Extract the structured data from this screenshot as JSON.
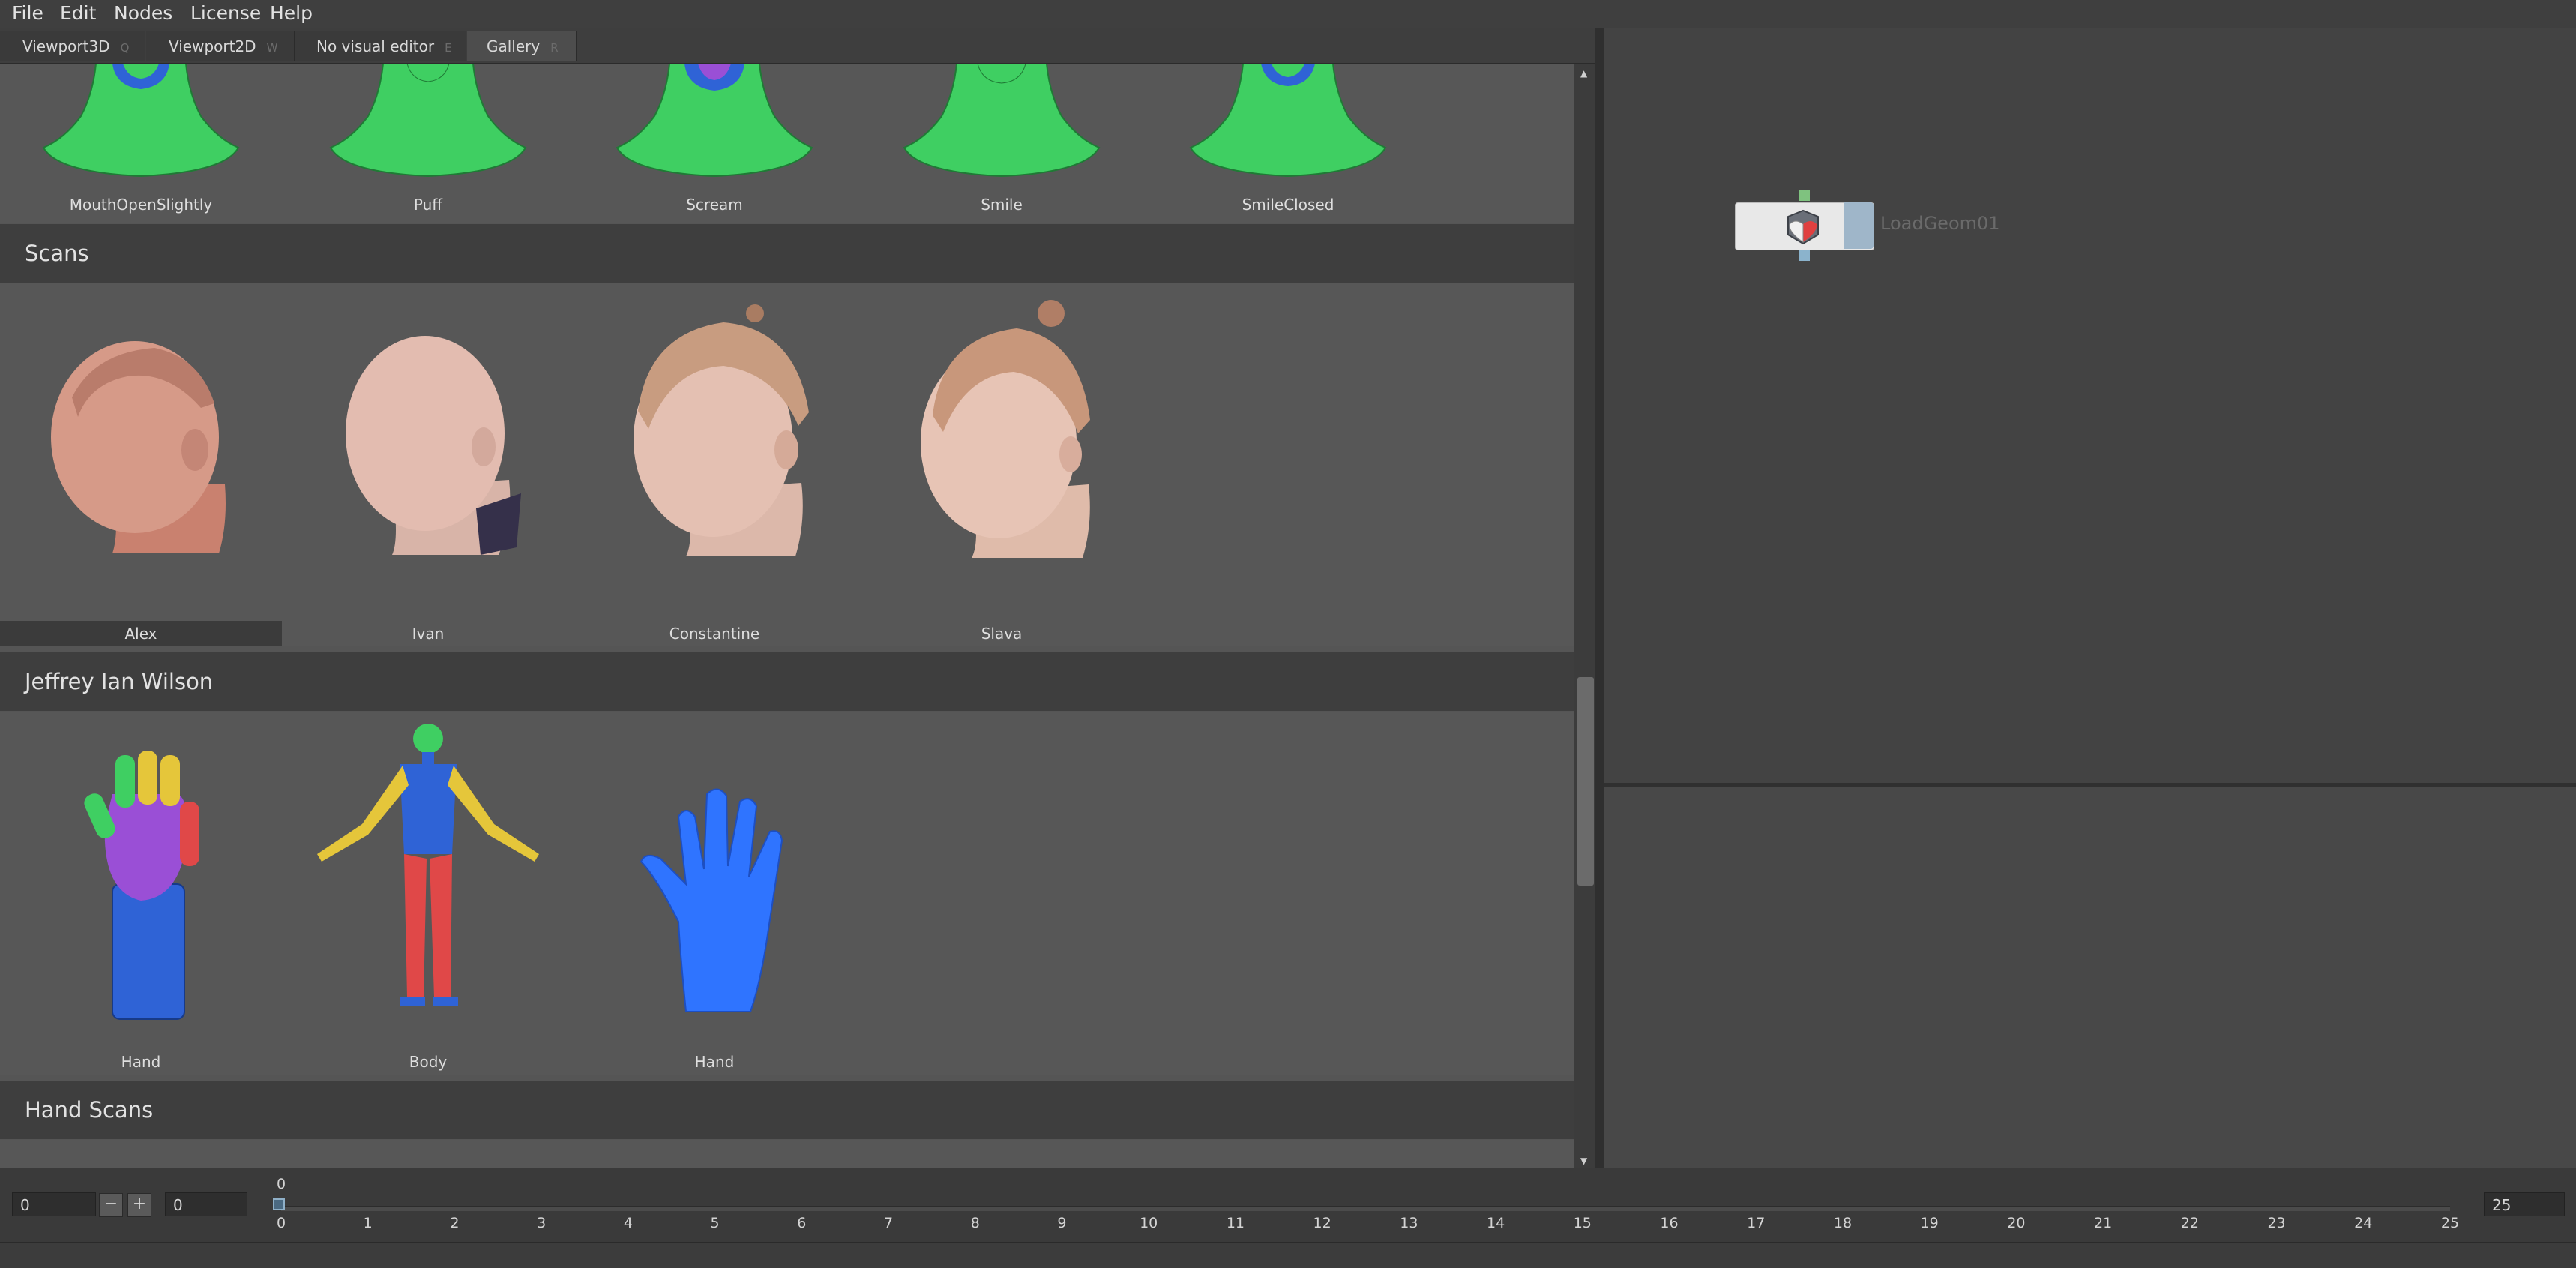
{
  "menu": [
    "File",
    "Edit",
    "Nodes",
    "License",
    "Help"
  ],
  "tabs": [
    {
      "label": "Viewport3D",
      "hotkey": "Q"
    },
    {
      "label": "Viewport2D",
      "hotkey": "W"
    },
    {
      "label": "No visual editor",
      "hotkey": "E"
    },
    {
      "label": "Gallery",
      "hotkey": "R"
    }
  ],
  "gallery": {
    "expressions_row": [
      "MouthOpenSlightly",
      "Puff",
      "Scream",
      "Smile",
      "SmileClosed"
    ],
    "sections": [
      {
        "title": "Scans",
        "items": [
          "Alex",
          "Ivan",
          "Constantine",
          "Slava"
        ],
        "selected": "Alex"
      },
      {
        "title": "Jeffrey Ian Wilson",
        "items": [
          "Hand",
          "Body",
          "Hand"
        ]
      },
      {
        "title": "Hand Scans",
        "items": []
      }
    ]
  },
  "node": {
    "label": "LoadGeom01",
    "icon": "load-geometry-icon"
  },
  "timeline": {
    "start_value": "0",
    "range_start": "0",
    "end_value": "25",
    "current_frame": "0",
    "ticks": [
      "0",
      "1",
      "2",
      "3",
      "4",
      "5",
      "6",
      "7",
      "8",
      "9",
      "10",
      "11",
      "12",
      "13",
      "14",
      "15",
      "16",
      "17",
      "18",
      "19",
      "20",
      "21",
      "22",
      "23",
      "24",
      "25"
    ],
    "minus_label": "−",
    "plus_label": "+"
  },
  "colors": {
    "mesh_green": "#3fcf62",
    "mesh_blue": "#2f63d6",
    "accent_blue": "#8fb0c8"
  }
}
